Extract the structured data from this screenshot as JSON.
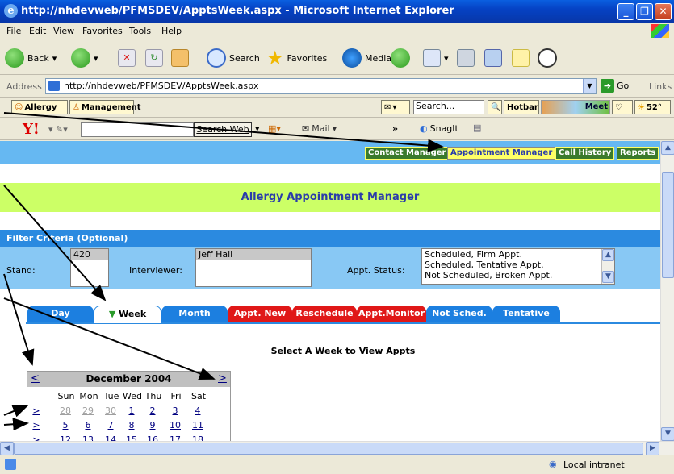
{
  "window": {
    "title": "http://nhdevweb/PFMSDEV/ApptsWeek.aspx - Microsoft Internet Explorer"
  },
  "menu": [
    "File",
    "Edit",
    "View",
    "Favorites",
    "Tools",
    "Help"
  ],
  "toolbar": {
    "back": "Back",
    "search": "Search",
    "favorites": "Favorites",
    "media": "Media"
  },
  "address": {
    "label": "Address",
    "url": "http://nhdevweb/PFMSDEV/ApptsWeek.aspx",
    "go": "Go",
    "links": "Links"
  },
  "links_bar": {
    "allergy": "Allergy",
    "management": "Management",
    "search_placeholder": "Search...",
    "hotbar": "Hotbar",
    "meet": "Meet",
    "temp": "52°"
  },
  "yahoo_bar": {
    "search_web": "Search Web",
    "mail": "Mail",
    "snagit": "SnagIt",
    "more": "»"
  },
  "nav": {
    "contact": "Contact Manager",
    "appointment": "Appointment Manager",
    "call_history": "Call History",
    "reports": "Reports"
  },
  "banner": "Allergy Appointment Manager",
  "filter": {
    "header": "Filter Criteria (Optional)",
    "stand_label": "Stand:",
    "stand_value": "420",
    "interviewer_label": "Interviewer:",
    "interviewer_value": "Jeff Hall",
    "status_label": "Appt. Status:",
    "status_options": [
      "Scheduled, Firm Appt.",
      "Scheduled, Tentative Appt.",
      "Not Scheduled, Broken Appt."
    ]
  },
  "tabs": [
    {
      "label": "Day",
      "color": "#1c7fe0"
    },
    {
      "label": "Week",
      "color": "#ffffff"
    },
    {
      "label": "Month",
      "color": "#1c7fe0"
    },
    {
      "label": "Appt. New",
      "color": "#e01818"
    },
    {
      "label": "Reschedule",
      "color": "#e01818"
    },
    {
      "label": "Appt.Monitor",
      "color": "#e01818"
    },
    {
      "label": "Not Sched.",
      "color": "#1c7fe0"
    },
    {
      "label": "Tentative",
      "color": "#1c7fe0"
    }
  ],
  "prompt": "Select A Week to View Appts",
  "calendar": {
    "month": "December 2004",
    "prev": "<",
    "next": ">",
    "days": [
      "Sun",
      "Mon",
      "Tue",
      "Wed",
      "Thu",
      "Fri",
      "Sat"
    ],
    "week_selector": ">",
    "weeks": [
      [
        {
          "d": "28",
          "g": true
        },
        {
          "d": "29",
          "g": true
        },
        {
          "d": "30",
          "g": true
        },
        {
          "d": "1"
        },
        {
          "d": "2"
        },
        {
          "d": "3"
        },
        {
          "d": "4"
        }
      ],
      [
        {
          "d": "5"
        },
        {
          "d": "6"
        },
        {
          "d": "7"
        },
        {
          "d": "8"
        },
        {
          "d": "9"
        },
        {
          "d": "10"
        },
        {
          "d": "11"
        }
      ],
      [
        {
          "d": "12"
        },
        {
          "d": "13"
        },
        {
          "d": "14"
        },
        {
          "d": "15"
        },
        {
          "d": "16"
        },
        {
          "d": "17"
        },
        {
          "d": "18"
        }
      ]
    ]
  },
  "status": {
    "zone": "Local intranet"
  }
}
